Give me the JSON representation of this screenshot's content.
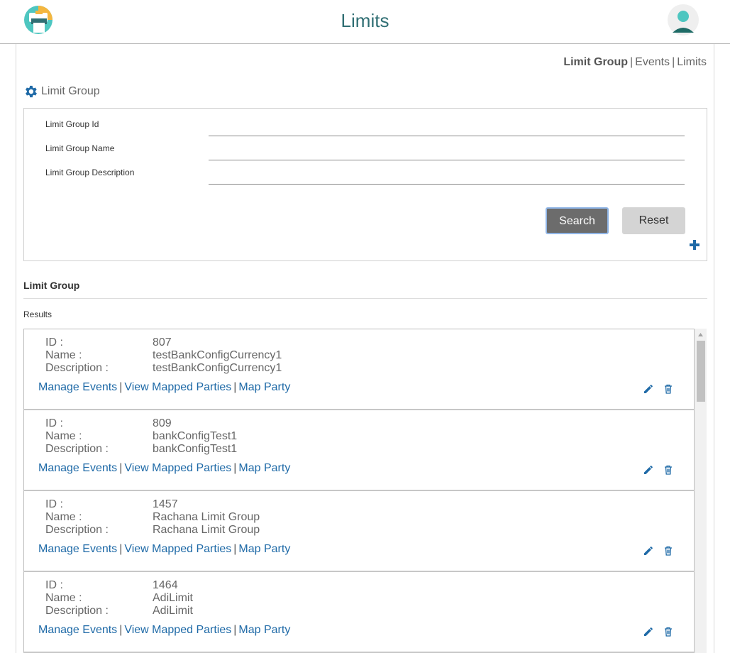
{
  "header": {
    "title": "Limits",
    "logo_icon": "print-shop-logo-icon",
    "avatar_icon": "user-avatar-icon"
  },
  "nav": {
    "items": [
      {
        "label": "Limit Group",
        "active": true
      },
      {
        "label": "Events",
        "active": false
      },
      {
        "label": "Limits",
        "active": false
      }
    ],
    "separator": "|"
  },
  "search_section": {
    "title": "Limit Group",
    "icon": "gear-icon",
    "fields": [
      {
        "label": "Limit Group Id",
        "value": ""
      },
      {
        "label": "Limit Group Name",
        "value": ""
      },
      {
        "label": "Limit Group Description",
        "value": ""
      }
    ],
    "search_label": "Search",
    "reset_label": "Reset",
    "add_icon": "plus-icon"
  },
  "results_section": {
    "title": "Limit Group",
    "subtitle": "Results",
    "key_labels": {
      "id": "ID :",
      "name": "Name :",
      "description": "Description :"
    },
    "actions": {
      "manage_events": "Manage Events",
      "view_mapped_parties": "View Mapped Parties",
      "map_party": "Map Party"
    },
    "items": [
      {
        "id": "807",
        "name": "testBankConfigCurrency1",
        "description": "testBankConfigCurrency1"
      },
      {
        "id": "809",
        "name": "bankConfigTest1",
        "description": "bankConfigTest1"
      },
      {
        "id": "1457",
        "name": "Rachana Limit Group",
        "description": "Rachana Limit Group"
      },
      {
        "id": "1464",
        "name": "AdiLimit",
        "description": "AdiLimit"
      }
    ]
  },
  "colors": {
    "brand": "#2f6e73",
    "link": "#1f6aa7",
    "primary_button": "#6c6c6c",
    "secondary_button": "#d4d4d4"
  }
}
